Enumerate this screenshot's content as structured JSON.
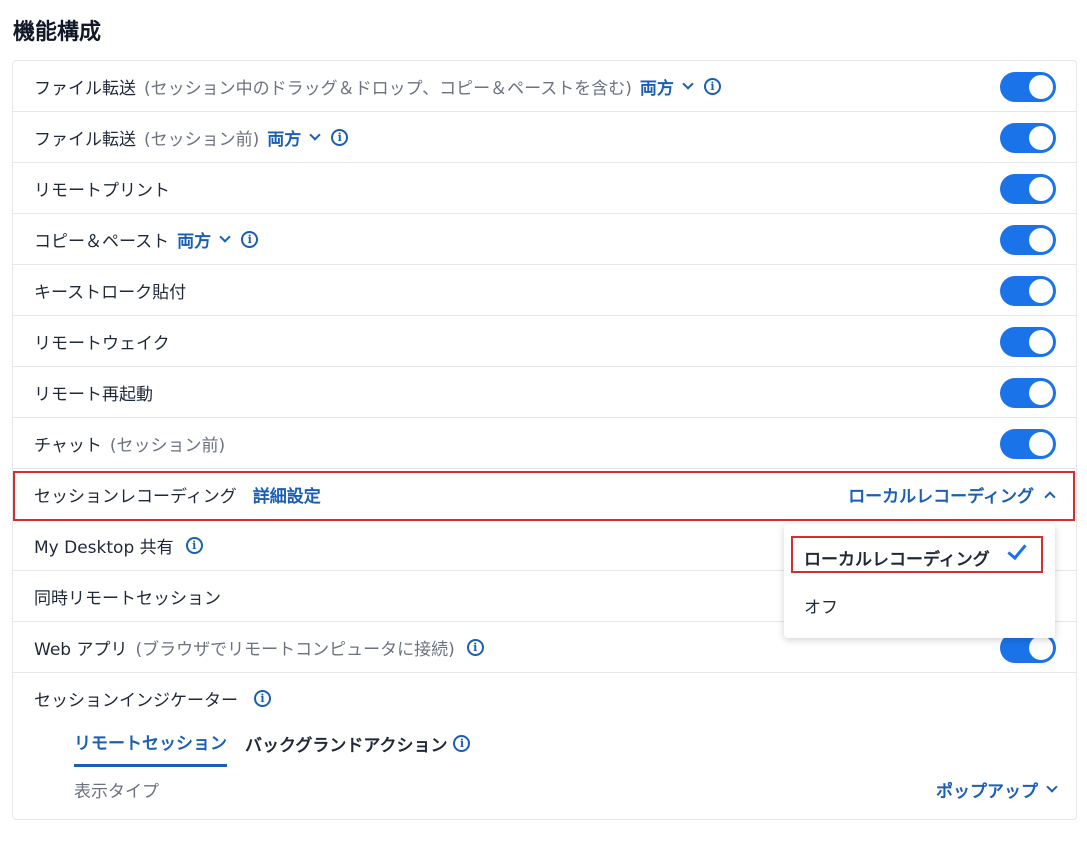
{
  "section_title": "機能構成",
  "rows": [
    {
      "label": "ファイル転送",
      "muted": "(セッション中のドラッグ＆ドロップ、コピー＆ペーストを含む)",
      "link": "両方",
      "info": true,
      "toggle": true
    },
    {
      "label": "ファイル転送",
      "muted": "(セッション前)",
      "link": "両方",
      "info": true,
      "toggle": true
    },
    {
      "label": "リモートプリント",
      "toggle": true
    },
    {
      "label": "コピー＆ペースト",
      "link": "両方",
      "info": true,
      "toggle": true
    },
    {
      "label": "キーストローク貼付",
      "toggle": true
    },
    {
      "label": "リモートウェイク",
      "toggle": true
    },
    {
      "label": "リモート再起動",
      "toggle": true
    },
    {
      "label": "チャット",
      "muted": "(セッション前)",
      "toggle": true
    }
  ],
  "session_recording": {
    "label": "セッションレコーディング",
    "details_link": "詳細設定",
    "selected_value": "ローカルレコーディング"
  },
  "recording_dropdown": {
    "options": [
      "ローカルレコーディング",
      "オフ"
    ],
    "selected": "ローカルレコーディング"
  },
  "my_desktop": {
    "label": "My Desktop 共有"
  },
  "concurrent": {
    "label": "同時リモートセッション"
  },
  "web_app": {
    "label": "Web アプリ",
    "muted": "(ブラウザでリモートコンピュータに接続)"
  },
  "indicator": {
    "label": "セッションインジケーター",
    "tabs": [
      "リモートセッション",
      "バックグランドアクション"
    ],
    "display_type_label": "表示タイプ",
    "display_type_value": "ポップアップ"
  },
  "colors": {
    "accent": "#1a73e8",
    "link": "#1a5fb4",
    "highlight": "#d32f2f"
  }
}
